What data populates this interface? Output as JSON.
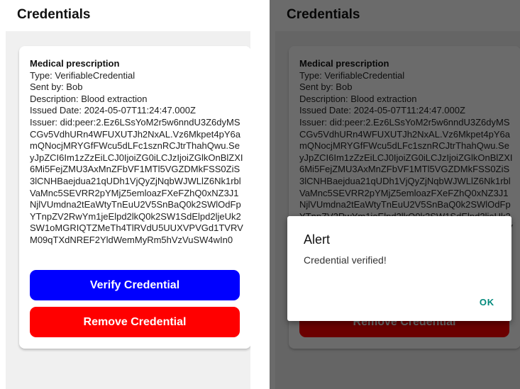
{
  "app": {
    "title": "Credentials"
  },
  "credential": {
    "title": "Medical prescription",
    "type": "Type: VerifiableCredential",
    "sent_by": "Sent by: Bob",
    "description": "Description: Blood extraction",
    "issued_date": "Issued Date: 2024-05-07T11:24:47.000Z",
    "issuer": "Issuer: did:peer:2.Ez6LSsYoM2r5w6nndU3Z6dyMSCGv5VdhURn4WFUXUTJh2NxAL.Vz6Mkpet4pY6amQNocjMRYGfFWcu5dLFc1sznRCJtrThahQwu.SeyJpZCI6Im1zZzEiLCJ0IjoiZG0iLCJzIjoiZGlkOnBlZXI6Mi5FejZMU3AxMnZFbVF1MTl5VGZDMkFSS0ZiS3lCNHBaejdua21qUDh1VjQyZjNqbWJWLlZ6Nk1rblVaMnc5SEVRR2pYMjZ5emloazFXeFZhQ0xNZ3J1NjlVUmdna2tEaWtyTnEuU2V5SnBaQ0k2SWlOdFpYTnpZV2RwYm1jeElpd2lkQ0k2SW1SdElpd2ljeUk2SW1oMGRIQTZMeTh4TlRVdU5UUXVPVGd1TVRVM09qTXdNREF2YldWemMyRm5hVzVuSW4wIn0"
  },
  "buttons": {
    "verify_label": "Verify Credential",
    "remove_label": "Remove Credential"
  },
  "alert": {
    "title": "Alert",
    "message": "Credential verified!",
    "ok_label": "OK"
  },
  "colors": {
    "verify_button": "#0000ff",
    "remove_button": "#ff0000",
    "dialog_action": "#00897b",
    "content_background": "#f0f0f0"
  }
}
